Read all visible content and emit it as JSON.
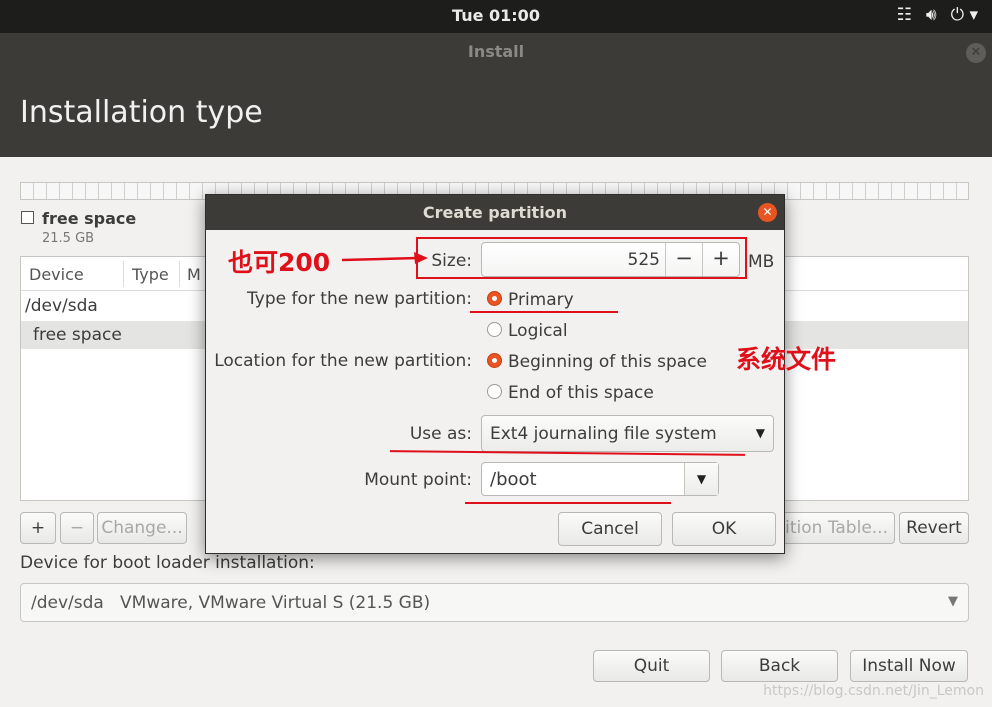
{
  "topbar": {
    "clock": "Tue 01:00",
    "network_icon": "network-icon",
    "volume_icon": "volume-icon",
    "power_icon": "power-icon"
  },
  "window": {
    "title": "Install"
  },
  "header": {
    "title": "Installation type"
  },
  "legend": {
    "label": "free space",
    "size": "21.5 GB"
  },
  "table": {
    "columns": [
      "Device",
      "Type",
      "M"
    ],
    "rows": [
      {
        "device": "/dev/sda"
      },
      {
        "device": "free space"
      }
    ]
  },
  "table_buttons": {
    "add": "+",
    "remove": "−",
    "change": "Change...",
    "new_table": "ition Table...",
    "revert": "Revert"
  },
  "boot": {
    "label": "Device for boot loader installation:",
    "value": "/dev/sda   VMware, VMware Virtual S (21.5 GB)"
  },
  "nav_buttons": {
    "quit": "Quit",
    "back": "Back",
    "install_now": "Install Now"
  },
  "watermark": "https://blog.csdn.net/Jin_Lemon",
  "dialog": {
    "title": "Create partition",
    "size_label": "Size:",
    "size_value": "525",
    "size_unit": "MB",
    "decrement": "−",
    "increment": "+",
    "type_label": "Type for the new partition:",
    "type_options": [
      {
        "label": "Primary",
        "selected": true
      },
      {
        "label": "Logical",
        "selected": false
      }
    ],
    "location_label": "Location for the new partition:",
    "location_options": [
      {
        "label": "Beginning of this space",
        "selected": true
      },
      {
        "label": "End of this space",
        "selected": false
      }
    ],
    "use_as_label": "Use as:",
    "use_as_value": "Ext4 journaling file system",
    "mount_label": "Mount point:",
    "mount_value": "/boot",
    "cancel": "Cancel",
    "ok": "OK"
  },
  "annotations": {
    "size_note": "也可200",
    "system_note": "系统文件",
    "color": "#e0101a"
  }
}
